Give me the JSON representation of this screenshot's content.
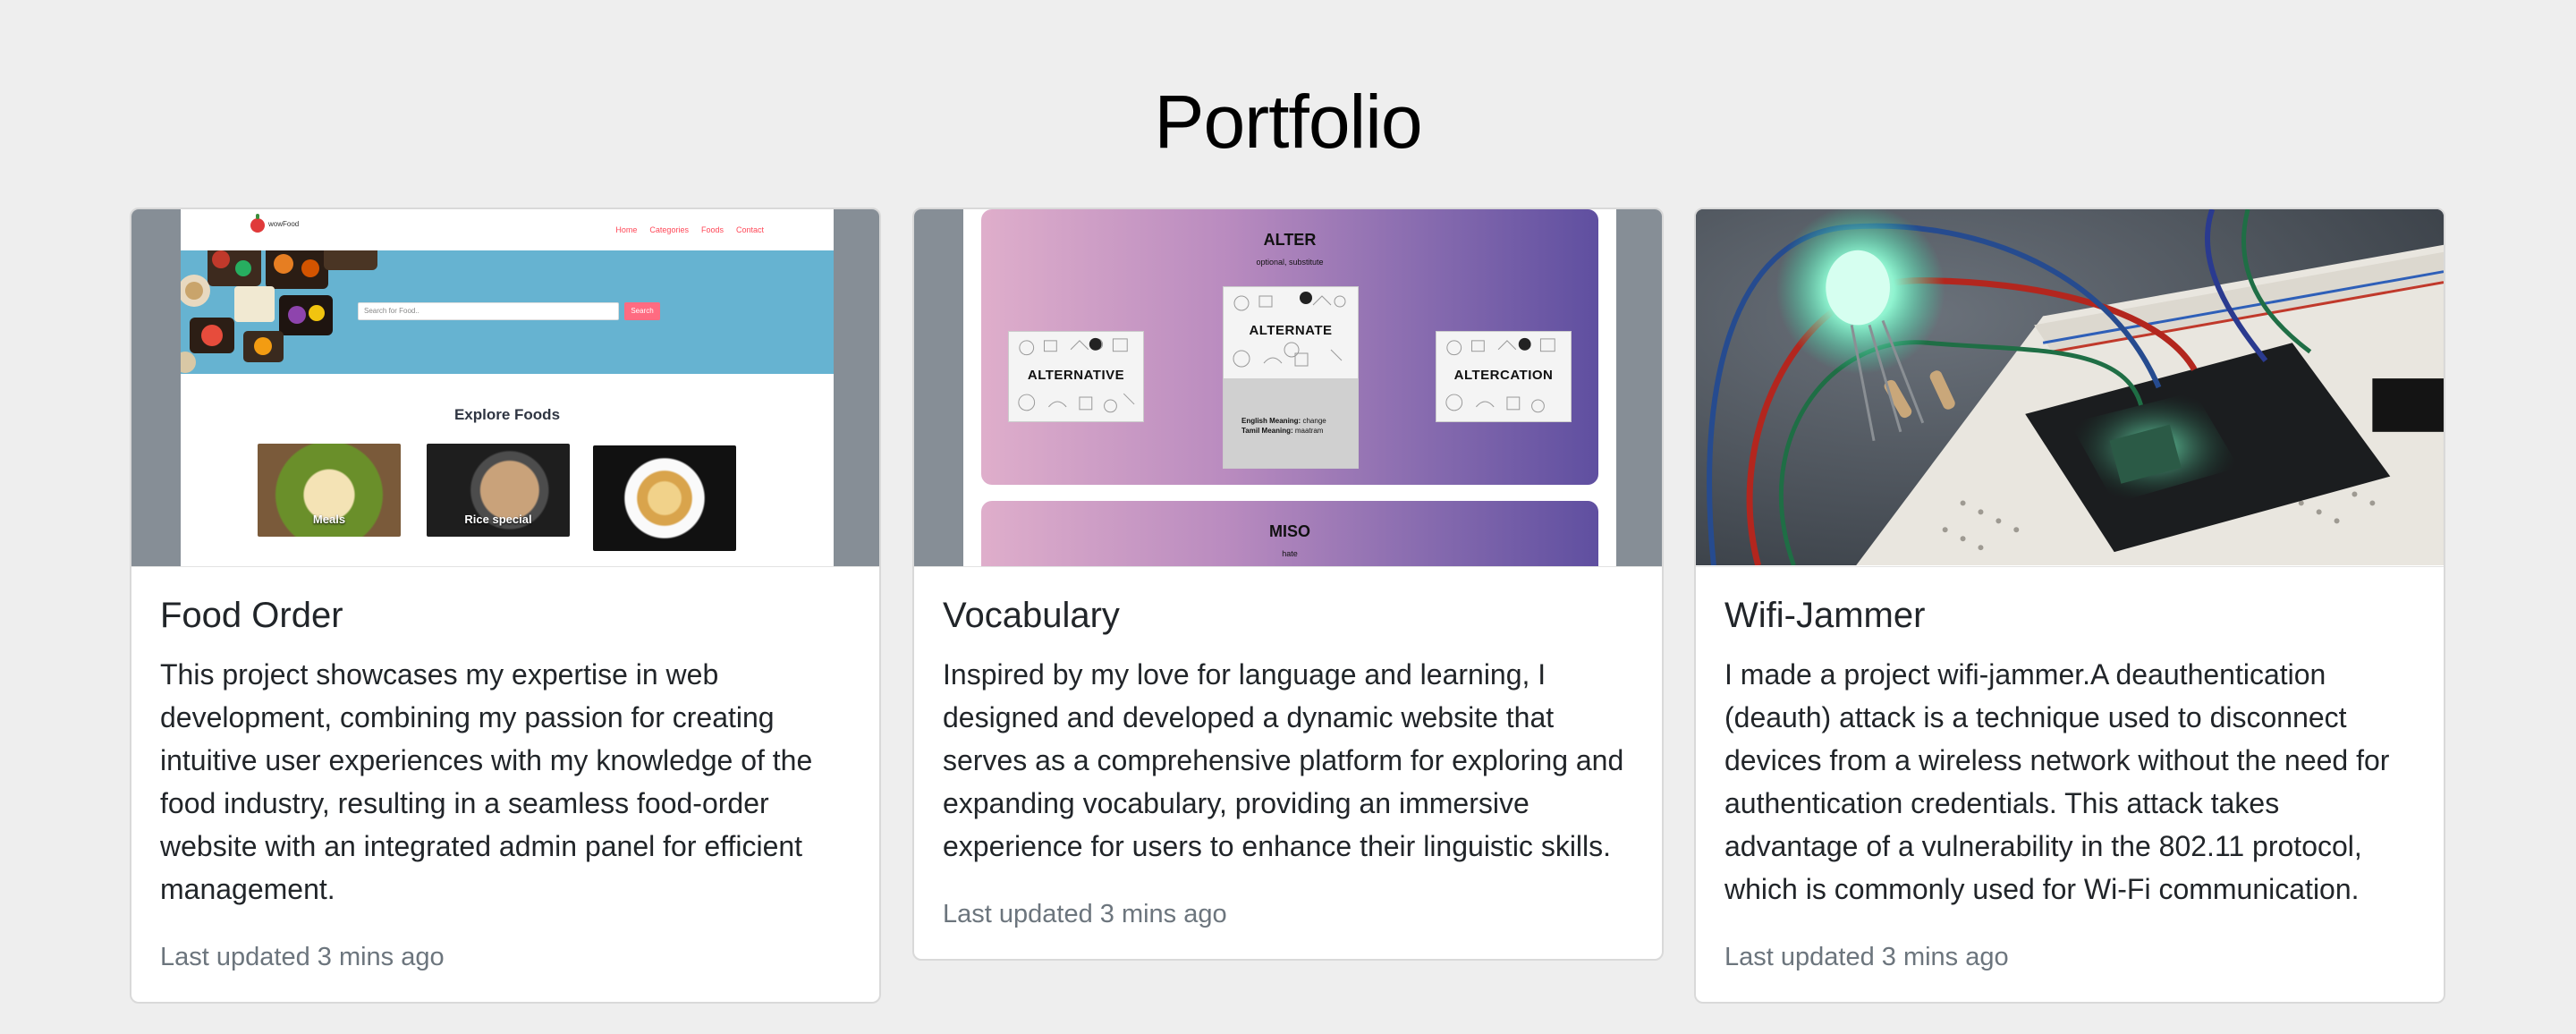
{
  "page": {
    "title": "Portfolio"
  },
  "cards": [
    {
      "title": "Food Order",
      "text": "This project showcases my expertise in web development, combining my passion for creating intuitive user experiences with my knowledge of the food industry, resulting in a seamless food-order website with an integrated admin panel for efficient management.",
      "meta": "Last updated 3 mins ago",
      "image": {
        "logo_text": "wowFood",
        "nav_links": [
          "Home",
          "Categories",
          "Foods",
          "Contact"
        ],
        "search_placeholder": "Search for Food..",
        "search_button": "Search",
        "section_heading": "Explore Foods",
        "categories": [
          "Meals",
          "Rice special",
          ""
        ]
      }
    },
    {
      "title": "Vocabulary",
      "text": "Inspired by my love for language and learning, I designed and developed a dynamic website that serves as a comprehensive platform for exploring and expanding vocabulary, providing an immersive experience for users to enhance their linguistic skills.",
      "meta": "Last updated 3 mins ago",
      "image": {
        "word": "ALTER",
        "subtitle": "optional, substitute",
        "cards": [
          "ALTERNATIVE",
          "ALTERNATE",
          "ALTERCATION"
        ],
        "english_label": "English Meaning:",
        "english_value": "change",
        "tamil_label": "Tamil Meaning:",
        "tamil_value": "maatram",
        "next_word": "MISO",
        "next_subtitle": "hate"
      }
    },
    {
      "title": "Wifi-Jammer",
      "text": "I made a project wifi-jammer.A deauthentication (deauth) attack is a technique used to disconnect devices from a wireless network without the need for authentication credentials. This attack takes advantage of a vulnerability in the 802.11 protocol, which is commonly used for Wi-Fi communication.",
      "meta": "Last updated 3 mins ago"
    }
  ],
  "colors": {
    "background": "#eeeeee",
    "card_border": "#d9d9d9",
    "muted_text": "#6c757d",
    "food_hero": "#66b3d1",
    "food_accent": "#ff4757",
    "vocab_gradient_start": "#dfaecb",
    "vocab_gradient_end": "#5f4fa0"
  }
}
